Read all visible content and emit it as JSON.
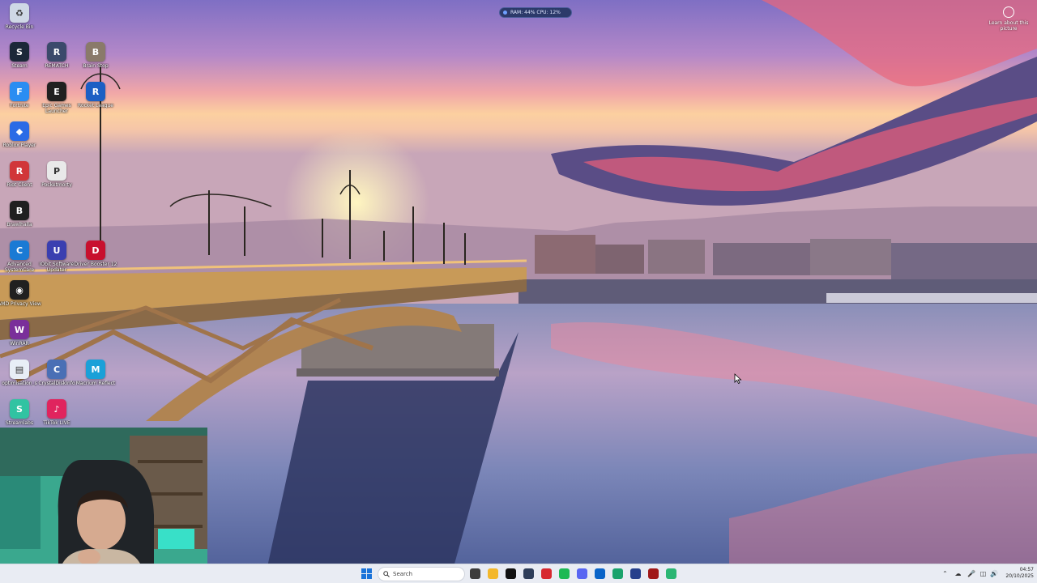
{
  "perf_widget": {
    "text": "RAM: 44%  CPU: 12%"
  },
  "learn_picture": {
    "label": "Learn about this picture"
  },
  "desktop_icons": [
    {
      "label": "Recycle Bin",
      "color": "#cfd8e6",
      "glyph": "♻"
    },
    {
      "label": "Steam",
      "color": "#1b2838",
      "glyph": "S"
    },
    {
      "label": "REMATCH",
      "color": "#3b4a6b",
      "glyph": "R"
    },
    {
      "label": "Brain Stop",
      "color": "#8a7a6a",
      "glyph": "B"
    },
    {
      "label": "Fortnite",
      "color": "#2a8df2",
      "glyph": "F"
    },
    {
      "label": "Epic Games Launcher",
      "color": "#202020",
      "glyph": "E"
    },
    {
      "label": "Rocket League",
      "color": "#1c5fc4",
      "glyph": "R"
    },
    {
      "label": "Roblox Player",
      "color": "#2b6be6",
      "glyph": "◆"
    },
    {
      "label": "Riot Client",
      "color": "#d13639",
      "glyph": "R"
    },
    {
      "label": "Pocketmorty",
      "color": "#e9e9e9",
      "glyph": "P"
    },
    {
      "label": "Brawlhalla",
      "color": "#202020",
      "glyph": "B"
    },
    {
      "label": "Advanced SystemCare",
      "color": "#1a7ad4",
      "glyph": "C"
    },
    {
      "label": "IObit Software Updater",
      "color": "#3a3fb0",
      "glyph": "U"
    },
    {
      "label": "Driver Booster 12",
      "color": "#c8102e",
      "glyph": "D"
    },
    {
      "label": "AMD Privacy View",
      "color": "#202020",
      "glyph": "◉"
    },
    {
      "label": "WinRAR",
      "color": "#7a2f9a",
      "glyph": "W"
    },
    {
      "label": "optimisation_s",
      "color": "#e8eef6",
      "glyph": "▤"
    },
    {
      "label": "CrystalDiskInfo",
      "color": "#4a6fb5",
      "glyph": "C"
    },
    {
      "label": "Macrium Reflect",
      "color": "#1aa0d8",
      "glyph": "M"
    },
    {
      "label": "Streamlabs",
      "color": "#31c3a2",
      "glyph": "S"
    },
    {
      "label": "TikTok LIVE",
      "color": "#e0245e",
      "glyph": "♪"
    }
  ],
  "taskbar": {
    "search_placeholder": "Search",
    "apps": [
      {
        "name": "task-view",
        "color": "#3c3c3c"
      },
      {
        "name": "file-explorer",
        "color": "#f3b72a"
      },
      {
        "name": "tiktok",
        "color": "#111111"
      },
      {
        "name": "calculator",
        "color": "#2e3d59"
      },
      {
        "name": "adobe",
        "color": "#d7282f"
      },
      {
        "name": "spotify",
        "color": "#1db954"
      },
      {
        "name": "discord",
        "color": "#5865f2"
      },
      {
        "name": "outlook",
        "color": "#0a64c8"
      },
      {
        "name": "edge",
        "color": "#1aa36c"
      },
      {
        "name": "app-blue",
        "color": "#26408c"
      },
      {
        "name": "app-red",
        "color": "#a01818"
      },
      {
        "name": "app-green",
        "color": "#2bb673"
      }
    ],
    "clock_time": "04:57",
    "clock_date": "20/10/2025"
  }
}
